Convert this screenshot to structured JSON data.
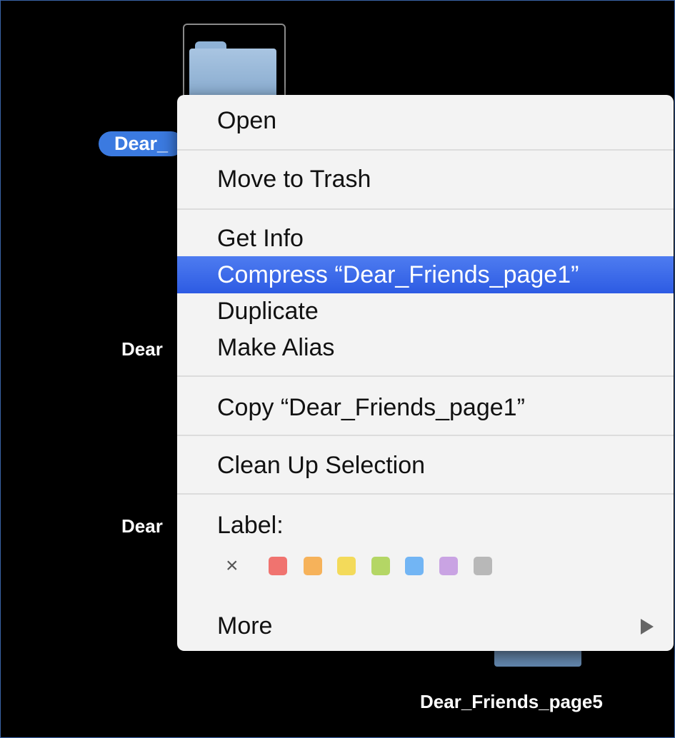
{
  "desktop": {
    "selected_label": "Dear_",
    "label_2": "Dear",
    "label_3": "Dear",
    "label_5": "Dear_Friends_page5"
  },
  "menu": {
    "open": "Open",
    "move_to_trash": "Move to Trash",
    "get_info": "Get Info",
    "compress": "Compress “Dear_Friends_page1”",
    "duplicate": "Duplicate",
    "make_alias": "Make Alias",
    "copy": "Copy “Dear_Friends_page1”",
    "clean_up": "Clean Up Selection",
    "label": "Label:",
    "remove_label_icon": "×",
    "more": "More"
  },
  "label_colors": [
    {
      "name": "red",
      "hex": "#f0736f"
    },
    {
      "name": "orange",
      "hex": "#f6b25a"
    },
    {
      "name": "yellow",
      "hex": "#f3da5a"
    },
    {
      "name": "green",
      "hex": "#b4d665"
    },
    {
      "name": "blue",
      "hex": "#72b5f4"
    },
    {
      "name": "purple",
      "hex": "#c9a3e3"
    },
    {
      "name": "gray",
      "hex": "#b8b8b8"
    }
  ],
  "colors": {
    "highlight": "#3565e8",
    "selection_pill": "#3b7ae0"
  }
}
